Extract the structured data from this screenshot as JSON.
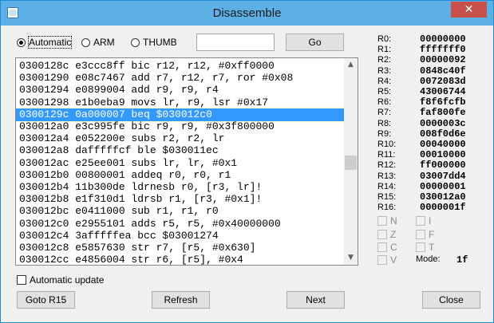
{
  "window": {
    "title": "Disassemble",
    "close_glyph": "✕"
  },
  "options": {
    "modes": [
      {
        "label": "Automatic",
        "selected": true
      },
      {
        "label": "ARM",
        "selected": false
      },
      {
        "label": "THUMB",
        "selected": false
      }
    ],
    "address_value": "",
    "go_label": "Go"
  },
  "listing": {
    "rows": [
      "0300128c e3ccc8ff bic r12, r12, #0xff0000",
      "03001290 e08c7467 add r7, r12, r7, ror #0x08",
      "03001294 e0899004 add r9, r9, r4",
      "03001298 e1b0eba9 movs lr, r9, lsr #0x17",
      "0300129c 0a000007 beq $030012c0",
      "030012a0 e3c995fe bic r9, r9, #0x3f800000",
      "030012a4 e052200e subs r2, r2, lr",
      "030012a8 dafffffcf ble $030011ec",
      "030012ac e25ee001 subs lr, lr, #0x1",
      "030012b0 00800001 addeq r0, r0, r1",
      "030012b4 11b300de ldrnesb r0, [r3, lr]!",
      "030012b8 e1f310d1 ldrsb r1, [r3, #0x1]!",
      "030012bc e0411000 sub r1, r1, r0",
      "030012c0 e2955101 adds r5, r5, #0x40000000",
      "030012c4 3afffffea bcc $03001274",
      "030012c8 e5857630 str r7, [r5, #0x630]",
      "030012cc e4856004 str r6, [r5], #0x4"
    ],
    "selected_index": 4
  },
  "registers": [
    {
      "name": "R0:",
      "value": "00000000"
    },
    {
      "name": "R1:",
      "value": "fffffff0"
    },
    {
      "name": "R2:",
      "value": "00000092"
    },
    {
      "name": "R3:",
      "value": "0848c40f"
    },
    {
      "name": "R4:",
      "value": "0072083d"
    },
    {
      "name": "R5:",
      "value": "43006744"
    },
    {
      "name": "R6:",
      "value": "f8f6fcfb"
    },
    {
      "name": "R7:",
      "value": "faf800fe"
    },
    {
      "name": "R8:",
      "value": "0000003c"
    },
    {
      "name": "R9:",
      "value": "008f0d6e"
    },
    {
      "name": "R10:",
      "value": "00040000"
    },
    {
      "name": "R11:",
      "value": "00010000"
    },
    {
      "name": "R12:",
      "value": "ff000000"
    },
    {
      "name": "R13:",
      "value": "03007dd4"
    },
    {
      "name": "R14:",
      "value": "00000001"
    },
    {
      "name": "R15:",
      "value": "030012a0"
    },
    {
      "name": "R16:",
      "value": "0000001f"
    }
  ],
  "flags": {
    "left": [
      "N",
      "Z",
      "C",
      "V"
    ],
    "right": [
      "I",
      "F",
      "T"
    ],
    "mode_label": "Mode:",
    "mode_value": "1f"
  },
  "auto_update_label": "Automatic update",
  "buttons": {
    "goto_r15": "Goto R15",
    "refresh": "Refresh",
    "next": "Next",
    "close": "Close"
  }
}
